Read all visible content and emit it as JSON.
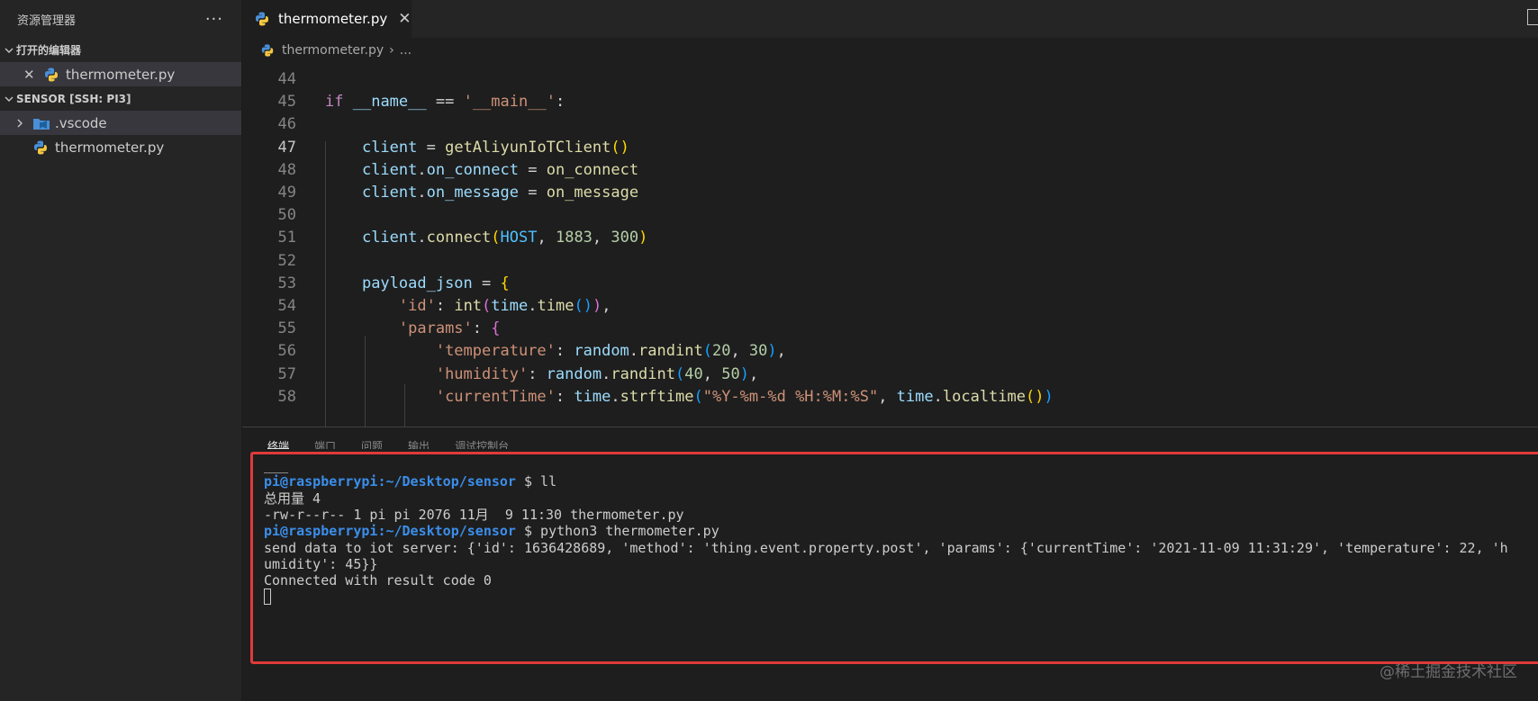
{
  "sidebar": {
    "title": "资源管理器",
    "more": "···",
    "open_editors": {
      "label": "打开的编辑器",
      "items": [
        {
          "name": "thermometer.py"
        }
      ]
    },
    "workspace": {
      "label": "SENSOR [SSH: PI3]",
      "items": [
        {
          "name": ".vscode",
          "type": "folder"
        },
        {
          "name": "thermometer.py",
          "type": "python"
        }
      ]
    }
  },
  "editor": {
    "tab": {
      "label": "thermometer.py",
      "close": "✕"
    },
    "breadcrumb": {
      "file": "thermometer.py",
      "sep": "›",
      "more": "..."
    },
    "current_line": 47,
    "lines": [
      {
        "n": "44",
        "tokens": []
      },
      {
        "n": "45",
        "tokens": [
          [
            "kw",
            "if"
          ],
          [
            "pl",
            " "
          ],
          [
            "var",
            "__name__"
          ],
          [
            "pl",
            " == "
          ],
          [
            "str",
            "'__main__'"
          ],
          [
            "pl",
            ":"
          ]
        ]
      },
      {
        "n": "46",
        "tokens": []
      },
      {
        "n": "47",
        "tokens": [
          [
            "pl",
            "    "
          ],
          [
            "var",
            "client"
          ],
          [
            "pl",
            " = "
          ],
          [
            "fn",
            "getAliyunIoTClient"
          ],
          [
            "br1",
            "()"
          ]
        ]
      },
      {
        "n": "48",
        "tokens": [
          [
            "pl",
            "    "
          ],
          [
            "var",
            "client"
          ],
          [
            "pl",
            "."
          ],
          [
            "var",
            "on_connect"
          ],
          [
            "pl",
            " = "
          ],
          [
            "fn",
            "on_connect"
          ]
        ]
      },
      {
        "n": "49",
        "tokens": [
          [
            "pl",
            "    "
          ],
          [
            "var",
            "client"
          ],
          [
            "pl",
            "."
          ],
          [
            "var",
            "on_message"
          ],
          [
            "pl",
            " = "
          ],
          [
            "fn",
            "on_message"
          ]
        ]
      },
      {
        "n": "50",
        "tokens": []
      },
      {
        "n": "51",
        "tokens": [
          [
            "pl",
            "    "
          ],
          [
            "var",
            "client"
          ],
          [
            "pl",
            "."
          ],
          [
            "fn",
            "connect"
          ],
          [
            "br1",
            "("
          ],
          [
            "const",
            "HOST"
          ],
          [
            "pl",
            ", "
          ],
          [
            "num",
            "1883"
          ],
          [
            "pl",
            ", "
          ],
          [
            "num",
            "300"
          ],
          [
            "br1",
            ")"
          ]
        ]
      },
      {
        "n": "52",
        "tokens": []
      },
      {
        "n": "53",
        "tokens": [
          [
            "pl",
            "    "
          ],
          [
            "var",
            "payload_json"
          ],
          [
            "pl",
            " = "
          ],
          [
            "br1",
            "{"
          ]
        ]
      },
      {
        "n": "54",
        "tokens": [
          [
            "pl",
            "        "
          ],
          [
            "str",
            "'id'"
          ],
          [
            "pl",
            ": "
          ],
          [
            "fn",
            "int"
          ],
          [
            "br2",
            "("
          ],
          [
            "var",
            "time"
          ],
          [
            "pl",
            "."
          ],
          [
            "fn",
            "time"
          ],
          [
            "br3",
            "()"
          ],
          [
            "br2",
            ")"
          ],
          [
            "pl",
            ","
          ]
        ]
      },
      {
        "n": "55",
        "tokens": [
          [
            "pl",
            "        "
          ],
          [
            "str",
            "'params'"
          ],
          [
            "pl",
            ": "
          ],
          [
            "br2",
            "{"
          ]
        ]
      },
      {
        "n": "56",
        "tokens": [
          [
            "pl",
            "            "
          ],
          [
            "str",
            "'temperature'"
          ],
          [
            "pl",
            ": "
          ],
          [
            "var",
            "random"
          ],
          [
            "pl",
            "."
          ],
          [
            "fn",
            "randint"
          ],
          [
            "br3",
            "("
          ],
          [
            "num",
            "20"
          ],
          [
            "pl",
            ", "
          ],
          [
            "num",
            "30"
          ],
          [
            "br3",
            ")"
          ],
          [
            "pl",
            ","
          ]
        ]
      },
      {
        "n": "57",
        "tokens": [
          [
            "pl",
            "            "
          ],
          [
            "str",
            "'humidity'"
          ],
          [
            "pl",
            ": "
          ],
          [
            "var",
            "random"
          ],
          [
            "pl",
            "."
          ],
          [
            "fn",
            "randint"
          ],
          [
            "br3",
            "("
          ],
          [
            "num",
            "40"
          ],
          [
            "pl",
            ", "
          ],
          [
            "num",
            "50"
          ],
          [
            "br3",
            ")"
          ],
          [
            "pl",
            ","
          ]
        ]
      },
      {
        "n": "58",
        "tokens": [
          [
            "pl",
            "            "
          ],
          [
            "str",
            "'currentTime'"
          ],
          [
            "pl",
            ": "
          ],
          [
            "var",
            "time"
          ],
          [
            "pl",
            "."
          ],
          [
            "fn",
            "strftime"
          ],
          [
            "br3",
            "("
          ],
          [
            "str",
            "\"%Y-%m-%d %H:%M:%S\""
          ],
          [
            "pl",
            ", "
          ],
          [
            "var",
            "time"
          ],
          [
            "pl",
            "."
          ],
          [
            "fn",
            "localtime"
          ],
          [
            "br1",
            "()"
          ],
          [
            "br3",
            ")"
          ]
        ]
      }
    ]
  },
  "panel": {
    "tabs": [
      "终端",
      "端口",
      "问题",
      "输出",
      "调试控制台"
    ],
    "active_tab": "终端",
    "terminal": {
      "lines": [
        {
          "type": "text",
          "text": "___"
        },
        {
          "type": "prompt",
          "user": "pi@raspberrypi",
          "path": ":~/Desktop/sensor",
          "cmd": " $ ll"
        },
        {
          "type": "text",
          "text": "总用量 4"
        },
        {
          "type": "text",
          "text": "-rw-r--r-- 1 pi pi 2076 11月  9 11:30 thermometer.py"
        },
        {
          "type": "prompt",
          "user": "pi@raspberrypi",
          "path": ":~/Desktop/sensor",
          "cmd": " $ python3 thermometer.py"
        },
        {
          "type": "text",
          "text": "send data to iot server: {'id': 1636428689, 'method': 'thing.event.property.post', 'params': {'currentTime': '2021-11-09 11:31:29', 'temperature': 22, 'h"
        },
        {
          "type": "text",
          "text": "umidity': 45}}"
        },
        {
          "type": "text",
          "text": "Connected with result code 0"
        }
      ]
    }
  },
  "watermark": "@稀土掘金技术社区"
}
